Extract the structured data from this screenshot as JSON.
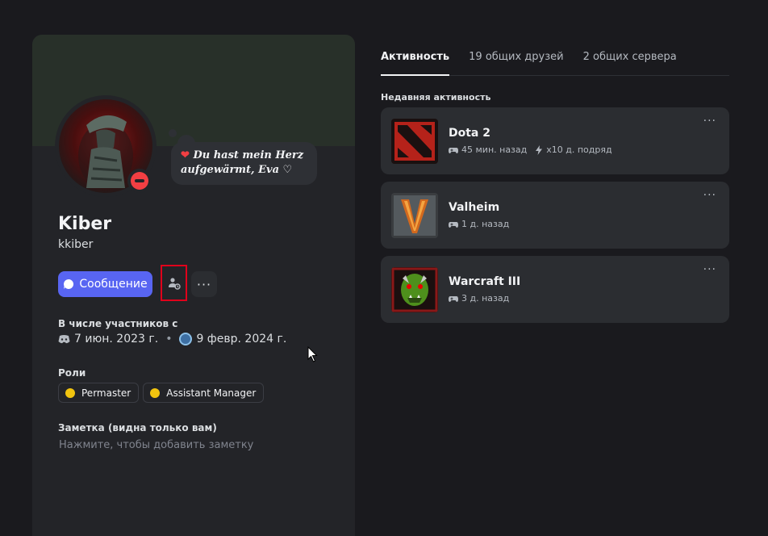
{
  "profile": {
    "display_name": "Kiber",
    "username": "kkiber",
    "status": "dnd",
    "custom_status": "Du hast mein Herz aufgewärmt, Eva ♡",
    "custom_status_emoji": "heart-icon"
  },
  "actions": {
    "message_label": "Сообщение",
    "add_friend_icon": "add-friend-icon",
    "more_label": "···"
  },
  "member_since": {
    "title": "В числе участников с",
    "discord_date": "7 июн. 2023 г.",
    "separator": "•",
    "server_date": "9 февр. 2024 г."
  },
  "roles": {
    "title": "Роли",
    "items": [
      {
        "name": "Permaster",
        "color": "#f1c40f"
      },
      {
        "name": "Assistant Manager",
        "color": "#f1c40f"
      }
    ]
  },
  "note": {
    "title": "Заметка (видна только вам)",
    "placeholder": "Нажмите, чтобы добавить заметку"
  },
  "tabs": [
    {
      "label": "Активность",
      "active": true
    },
    {
      "label": "19 общих друзей",
      "active": false
    },
    {
      "label": "2 общих сервера",
      "active": false
    }
  ],
  "activity": {
    "title": "Недавняя активность",
    "items": [
      {
        "name": "Dota 2",
        "time": "45 мин. назад",
        "streak": "x10 д. подряд"
      },
      {
        "name": "Valheim",
        "time": "1 д. назад"
      },
      {
        "name": "Warcraft III",
        "time": "3 д. назад"
      }
    ]
  },
  "colors": {
    "accent": "#5865f2",
    "dnd": "#f23f43",
    "role": "#f1c40f",
    "highlight_box": "#e0001b"
  }
}
